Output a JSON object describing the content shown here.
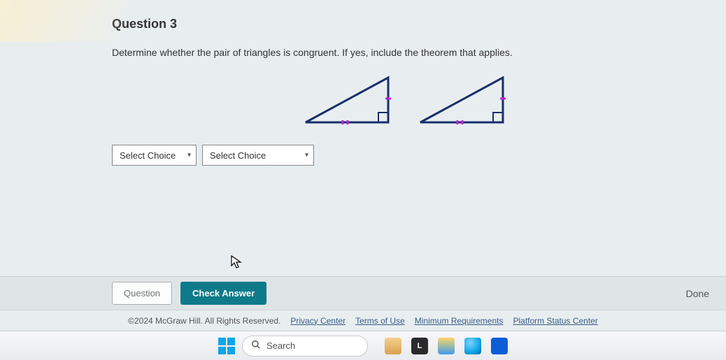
{
  "question": {
    "title": "Question 3",
    "prompt": "Determine whether the pair of triangles is congruent. If yes, include the theorem that applies."
  },
  "selects": {
    "choice1": {
      "placeholder": "Select Choice"
    },
    "choice2": {
      "placeholder": "Select Choice"
    }
  },
  "actions": {
    "prev": "Question",
    "check": "Check Answer",
    "done": "Done"
  },
  "footer": {
    "copyright": "©2024 McGraw Hill. All Rights Reserved.",
    "links": {
      "privacy": "Privacy Center",
      "terms": "Terms of Use",
      "minreq": "Minimum Requirements",
      "status": "Platform Status Center"
    }
  },
  "taskbar": {
    "search_placeholder": "Search",
    "icon_L": "L"
  }
}
